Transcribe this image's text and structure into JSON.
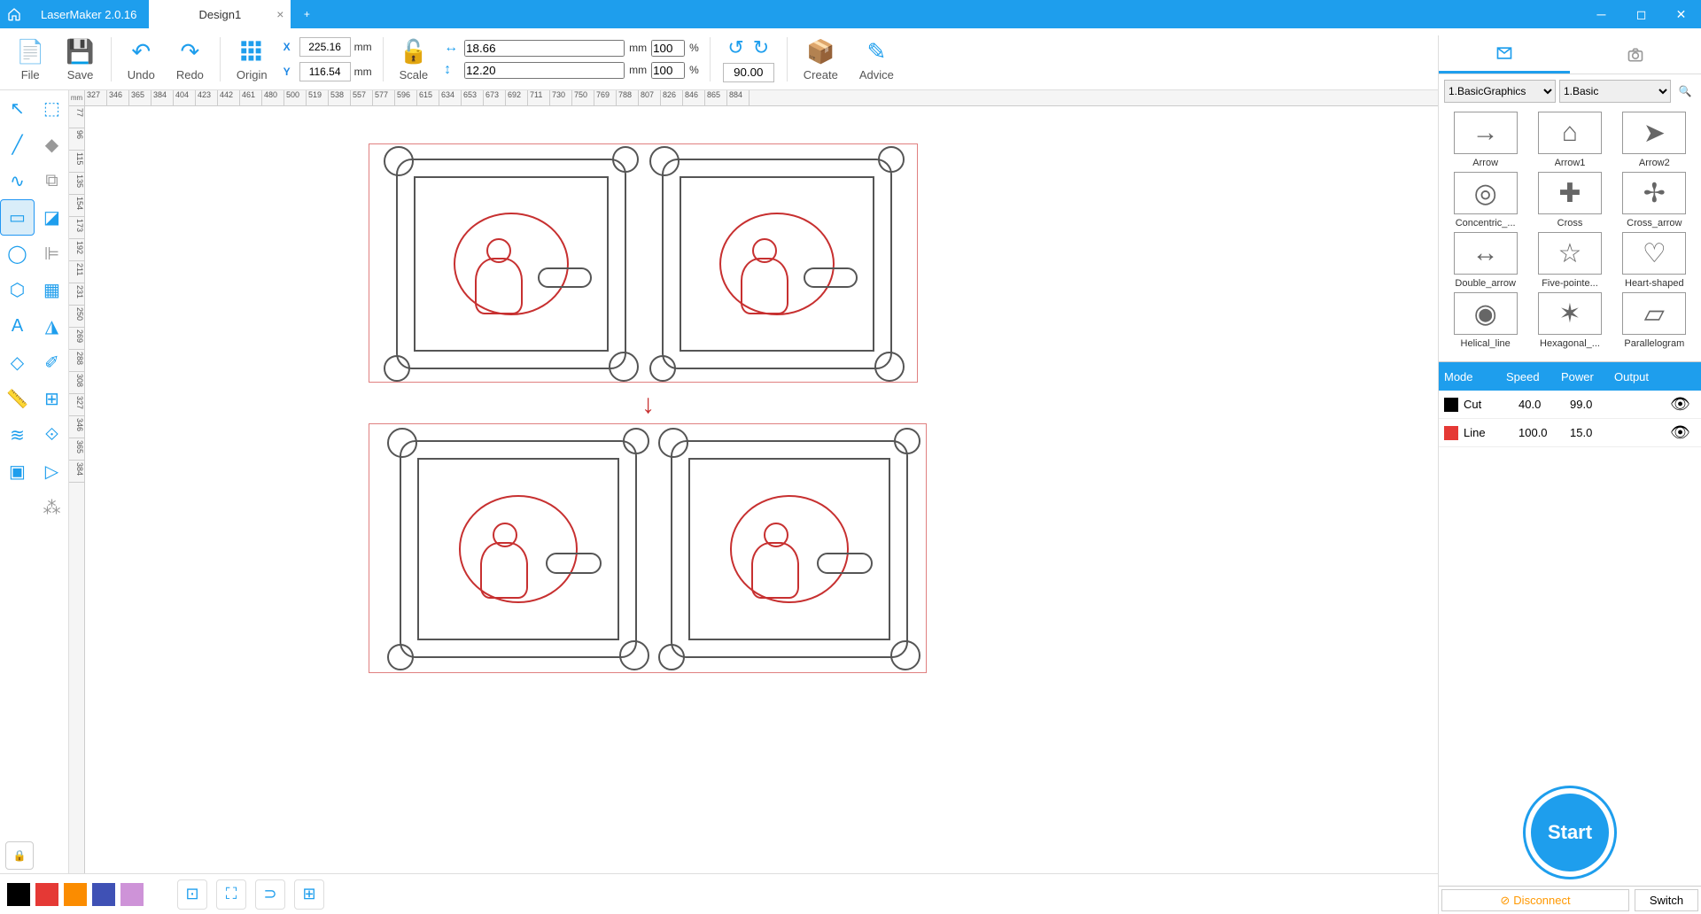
{
  "app": {
    "title": "LaserMaker 2.0.16"
  },
  "tabs": [
    {
      "title": "Design1"
    }
  ],
  "toolbar": {
    "file": "File",
    "save": "Save",
    "undo": "Undo",
    "redo": "Redo",
    "origin": "Origin",
    "scale": "Scale",
    "create": "Create",
    "advice": "Advice",
    "x": "225.16",
    "y": "116.54",
    "w": "18.66",
    "h": "12.20",
    "sx": "100",
    "sy": "100",
    "mm": "mm",
    "pct": "%",
    "angle": "90.00",
    "xlabel": "X",
    "ylabel": "Y"
  },
  "ruler_unit": "mm",
  "ruler_h": [
    "327",
    "346",
    "365",
    "384",
    "404",
    "423",
    "442",
    "461",
    "480",
    "500",
    "519",
    "538",
    "557",
    "577",
    "596",
    "615",
    "634",
    "653",
    "673",
    "692",
    "711",
    "730",
    "750",
    "769",
    "788",
    "807",
    "826",
    "846",
    "865",
    "884"
  ],
  "ruler_v": [
    "77",
    "96",
    "115",
    "135",
    "154",
    "173",
    "192",
    "211",
    "231",
    "250",
    "269",
    "288",
    "308",
    "327",
    "346",
    "365",
    "384"
  ],
  "shapes": {
    "cat1": "1.BasicGraphics",
    "cat2": "1.Basic",
    "items": [
      {
        "name": "Arrow",
        "g": "→"
      },
      {
        "name": "Arrow1",
        "g": "⌂"
      },
      {
        "name": "Arrow2",
        "g": "➤"
      },
      {
        "name": "Concentric_...",
        "g": "◎"
      },
      {
        "name": "Cross",
        "g": "✚"
      },
      {
        "name": "Cross_arrow",
        "g": "✢"
      },
      {
        "name": "Double_arrow",
        "g": "↔"
      },
      {
        "name": "Five-pointe...",
        "g": "☆"
      },
      {
        "name": "Heart-shaped",
        "g": "♡"
      },
      {
        "name": "Helical_line",
        "g": "◉"
      },
      {
        "name": "Hexagonal_...",
        "g": "✶"
      },
      {
        "name": "Parallelogram",
        "g": "▱"
      }
    ]
  },
  "layers": {
    "head": {
      "mode": "Mode",
      "speed": "Speed",
      "power": "Power",
      "output": "Output"
    },
    "rows": [
      {
        "color": "#000",
        "mode": "Cut",
        "speed": "40.0",
        "power": "99.0"
      },
      {
        "color": "#e53935",
        "mode": "Line",
        "speed": "100.0",
        "power": "15.0"
      }
    ]
  },
  "start": "Start",
  "conn": {
    "status": "Disconnect",
    "switch": "Switch"
  },
  "palette": [
    "#000000",
    "#e53935",
    "#fb8c00",
    "#3f51b5",
    "#ce93d8"
  ]
}
